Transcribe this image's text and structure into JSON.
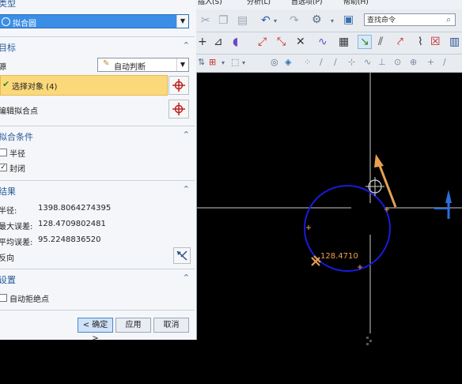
{
  "colors": {
    "accent": "#2a5a9a",
    "selection": "#fbd97a",
    "circle": "#1a1adc",
    "vector": "#e8a050"
  },
  "dialog": {
    "type_section": {
      "title": "类型",
      "selected": "拟合圆"
    },
    "target_section": {
      "title": "目标",
      "source_label": "源",
      "source_value": "自动判断",
      "select_object_label": "选择对象 (4)",
      "edit_points_label": "编辑拟合点"
    },
    "fit_conditions": {
      "title": "拟合条件",
      "radius_label": "半径",
      "closed_label": "封闭",
      "radius_checked": false,
      "closed_checked": true
    },
    "results": {
      "title": "结果",
      "radius_label": "半径:",
      "radius_value": "1398.8064274395",
      "max_error_label": "最大误差:",
      "max_error_value": "128.4709802481",
      "avg_error_label": "平均误差:",
      "avg_error_value": "95.2248836520",
      "reverse_label": "反向"
    },
    "settings": {
      "title": "设置",
      "auto_reject_label": "自动拒绝点",
      "auto_reject_checked": false
    },
    "buttons": {
      "ok": "< 确定 >",
      "apply": "应用",
      "cancel": "取消"
    }
  },
  "menubar": {
    "items": [
      "插入(S)",
      "分析(L)",
      "首选项(P)",
      "帮助(H)"
    ]
  },
  "toolbar": {
    "search_placeholder": "查找命令"
  },
  "viewport": {
    "annotation": "128.4710"
  }
}
